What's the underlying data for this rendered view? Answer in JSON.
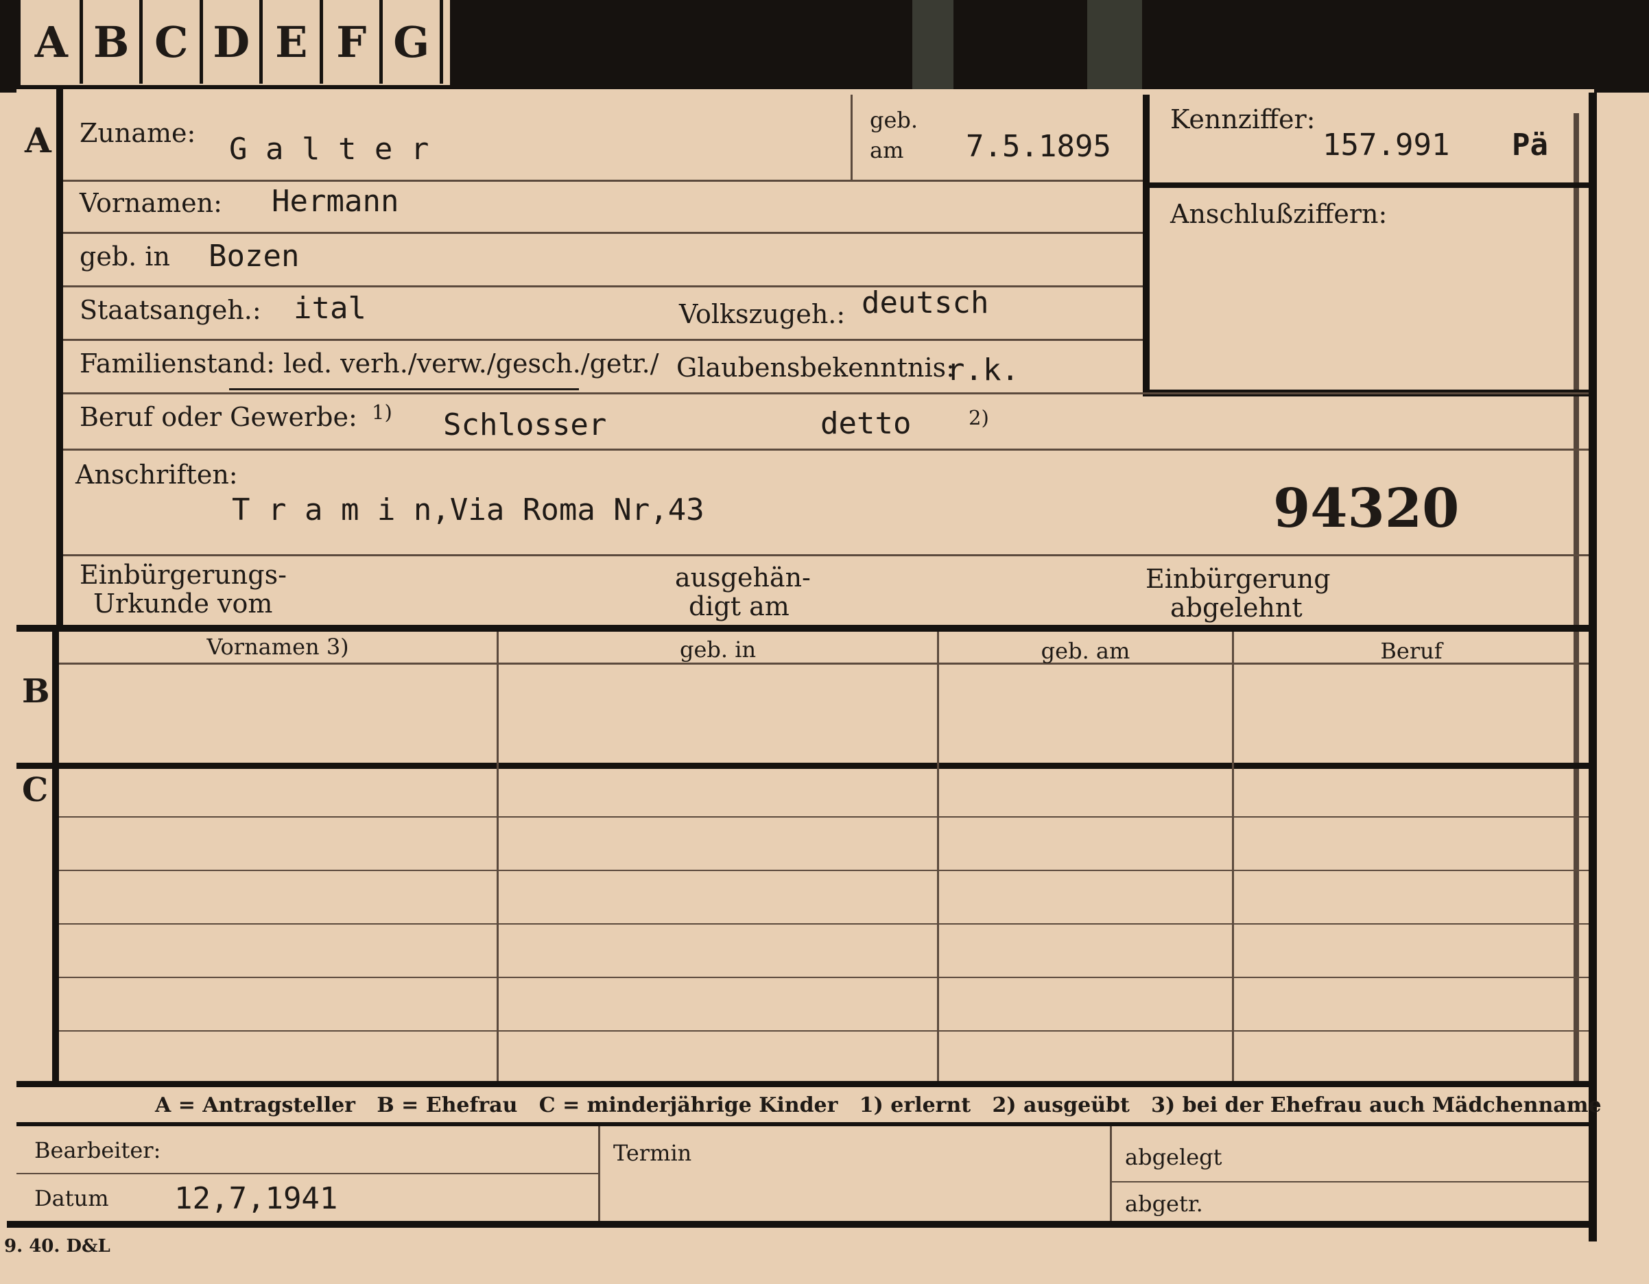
{
  "tabs": [
    "A",
    "B",
    "C",
    "D",
    "E",
    "F",
    "G"
  ],
  "section_letters": {
    "a": "A",
    "b": "B",
    "c": "C"
  },
  "header": {
    "zuname_label": "Zuname:",
    "zuname_value": "G a l t e r",
    "geb_label": "geb.",
    "am_label": "am",
    "geb_date": "7.5.1895",
    "kennziffer_label": "Kennziffer:",
    "kennziffer_value": "157.991",
    "kennziffer_suffix": "Pä",
    "anschluss_label": "Anschlußziffern:"
  },
  "fields": {
    "vornamen_label": "Vornamen:",
    "vornamen_value": "Hermann",
    "gebin_label": "geb. in",
    "gebin_value": "Bozen",
    "staatsangeh_label": "Staatsangeh.:",
    "staatsangeh_value": "ital",
    "volkszugeh_label": "Volkszugeh.:",
    "volkszugeh_value": "deutsch",
    "familienstand_label": "Familienstand: led. verh./verw./gesch./getr./",
    "glaubens_label": "Glaubensbekenntnis:",
    "glaubens_value": "r.k.",
    "beruf_label": "Beruf oder Gewerbe:",
    "beruf_sup1": "1)",
    "beruf_value1": "Schlosser",
    "beruf_value2": "detto",
    "beruf_sup2": "2)",
    "anschriften_label": "Anschriften:",
    "anschriften_value": "T r a m i n,Via Roma Nr,43",
    "anschriften_number": "94320",
    "einb_label_1": "Einbürgerungs-",
    "einb_label_2": "Urkunde vom",
    "ausgeh_label_1": "ausgehän-",
    "ausgeh_label_2": "digt am",
    "abgelehnt_label_1": "Einbürgerung",
    "abgelehnt_label_2": "abgelehnt"
  },
  "table": {
    "columns": [
      "Vornamen 3)",
      "geb. in",
      "geb. am",
      "Beruf"
    ]
  },
  "legend": "A = Antragsteller   B = Ehefrau   C = minderjährige Kinder   1) erlernt   2) ausgeübt   3) bei der Ehefrau auch Mädchenname",
  "footer": {
    "bearbeiter_label": "Bearbeiter:",
    "datum_label": "Datum",
    "datum_value": "12,7,1941",
    "termin_label": "Termin",
    "abgelegt_label": "abgelegt",
    "abgetr_label": "abgetr."
  },
  "printer_mark": "9. 40. D&L"
}
